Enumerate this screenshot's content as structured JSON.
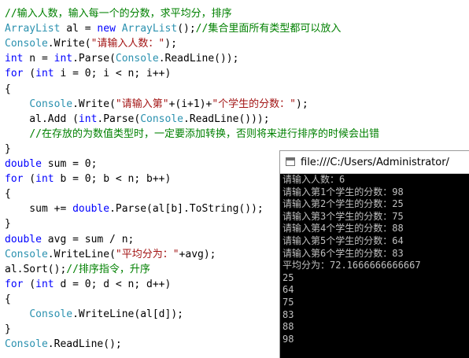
{
  "code_lines": [
    [
      [
        "cm",
        "//输入人数，输入每一个的分数，求平均分，排序"
      ]
    ],
    [
      [
        "ty",
        "ArrayList"
      ],
      [
        "pl",
        " al = "
      ],
      [
        "kw",
        "new"
      ],
      [
        "pl",
        " "
      ],
      [
        "ty",
        "ArrayList"
      ],
      [
        "pl",
        "();"
      ],
      [
        "cm",
        "//集合里面所有类型都可以放入"
      ]
    ],
    [
      [
        "ty",
        "Console"
      ],
      [
        "pl",
        ".Write("
      ],
      [
        "st",
        "\"请输入人数：\""
      ],
      [
        "pl",
        ");"
      ]
    ],
    [
      [
        "kw",
        "int"
      ],
      [
        "pl",
        " n = "
      ],
      [
        "kw",
        "int"
      ],
      [
        "pl",
        ".Parse("
      ],
      [
        "ty",
        "Console"
      ],
      [
        "pl",
        ".ReadLine());"
      ]
    ],
    [
      [
        "kw",
        "for"
      ],
      [
        "pl",
        " ("
      ],
      [
        "kw",
        "int"
      ],
      [
        "pl",
        " i = 0; i < n; i++)"
      ]
    ],
    [
      [
        "pl",
        "{"
      ]
    ],
    [
      [
        "pl",
        "    "
      ],
      [
        "ty",
        "Console"
      ],
      [
        "pl",
        ".Write("
      ],
      [
        "st",
        "\"请输入第\""
      ],
      [
        "pl",
        "+(i+1)+"
      ],
      [
        "st",
        "\"个学生的分数：\""
      ],
      [
        "pl",
        ");"
      ]
    ],
    [
      [
        "pl",
        "    al.Add ("
      ],
      [
        "kw",
        "int"
      ],
      [
        "pl",
        ".Parse("
      ],
      [
        "ty",
        "Console"
      ],
      [
        "pl",
        ".ReadLine()));"
      ]
    ],
    [
      [
        "pl",
        "    "
      ],
      [
        "cm",
        "//在存放的为数值类型时，一定要添加转换，否则将来进行排序的时候会出错"
      ]
    ],
    [
      [
        "pl",
        "}"
      ]
    ],
    [
      [
        "kw",
        "double"
      ],
      [
        "pl",
        " sum = 0;"
      ]
    ],
    [
      [
        "kw",
        "for"
      ],
      [
        "pl",
        " ("
      ],
      [
        "kw",
        "int"
      ],
      [
        "pl",
        " b = 0; b < n; b++)"
      ]
    ],
    [
      [
        "pl",
        "{"
      ]
    ],
    [
      [
        "pl",
        "    sum += "
      ],
      [
        "kw",
        "double"
      ],
      [
        "pl",
        ".Parse(al[b].ToString());"
      ]
    ],
    [
      [
        "pl",
        "}"
      ]
    ],
    [
      [
        "kw",
        "double"
      ],
      [
        "pl",
        " avg = sum / n;"
      ]
    ],
    [
      [
        "ty",
        "Console"
      ],
      [
        "pl",
        ".WriteLine("
      ],
      [
        "st",
        "\"平均分为：\""
      ],
      [
        "pl",
        "+avg);"
      ]
    ],
    [
      [
        "pl",
        "al.Sort();"
      ],
      [
        "cm",
        "//排序指令，升序"
      ]
    ],
    [
      [
        "kw",
        "for"
      ],
      [
        "pl",
        " ("
      ],
      [
        "kw",
        "int"
      ],
      [
        "pl",
        " d = 0; d < n; d++)"
      ]
    ],
    [
      [
        "pl",
        "{"
      ]
    ],
    [
      [
        "pl",
        "    "
      ],
      [
        "ty",
        "Console"
      ],
      [
        "pl",
        ".WriteLine(al[d]);"
      ]
    ],
    [
      [
        "pl",
        "}"
      ]
    ],
    [
      [
        "ty",
        "Console"
      ],
      [
        "pl",
        ".ReadLine();"
      ]
    ]
  ],
  "console": {
    "title": "file:///C:/Users/Administrator/",
    "output_lines": [
      "请输入人数：6",
      "请输入第1个学生的分数：98",
      "请输入第2个学生的分数：25",
      "请输入第3个学生的分数：75",
      "请输入第4个学生的分数：88",
      "请输入第5个学生的分数：64",
      "请输入第6个学生的分数：83",
      "平均分为：72.1666666666667",
      "25",
      "64",
      "75",
      "83",
      "88",
      "98"
    ]
  },
  "colors": {
    "keyword": "#0000ff",
    "type": "#2b91af",
    "string": "#a31515",
    "comment": "#008000",
    "plain": "#000000",
    "console_bg": "#000000",
    "console_text": "#c0c0c0"
  },
  "icons": {
    "console_window": "console-window-icon"
  }
}
